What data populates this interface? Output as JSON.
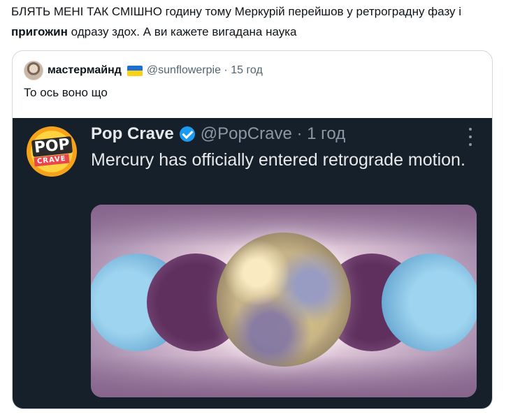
{
  "tweet": {
    "text_part1": "БЛЯТЬ МЕНІ ТАК СМІШНО годину тому Меркурій перейшов у ретроградну фазу і ",
    "bold": "пригожин",
    "text_part2": " одразу здох. А ви кажете вигадана наука"
  },
  "quote": {
    "name": "мастермайнд",
    "flag_icon": "ukraine-flag-icon",
    "handle_time": "@sunflowerpie · 15 год",
    "text": "То ось воно що"
  },
  "embedded": {
    "logo_line1": "POP",
    "logo_line2": "CRAVE",
    "name": "Pop Crave",
    "handle_time": "@PopCrave · 1 год",
    "text": "Mercury has officially entered retrograde motion."
  },
  "colors": {
    "verified": "#1d9bf0",
    "dark_bg": "#15202b",
    "border": "#cfd9de"
  }
}
